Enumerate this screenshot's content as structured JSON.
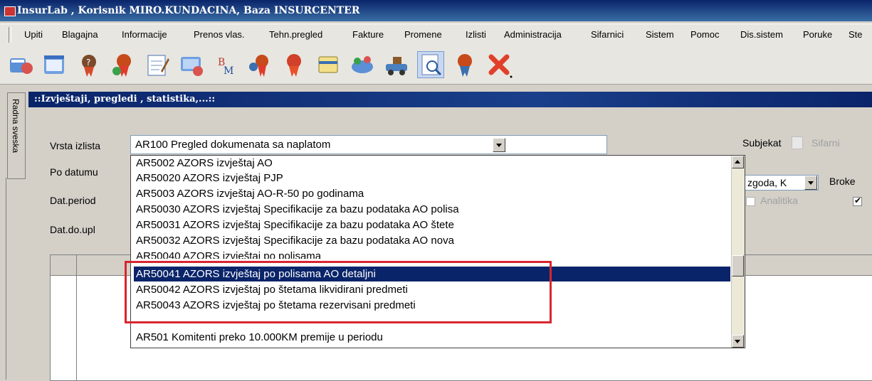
{
  "window": {
    "title": "InsurLab , Korisnik MIRO.KUNDACINA, Baza INSURCENTER"
  },
  "menu": [
    "Upiti",
    "Blagajna",
    "Informacije",
    "Prenos vlas.",
    "Tehn.pregled",
    "Fakture",
    "Promene",
    "Izlisti",
    "Administracija",
    "Sifarnici",
    "Sistem",
    "Pomoc",
    "Dis.sistem",
    "Poruke",
    "Ste"
  ],
  "toolbar_icons": [
    "users-icon",
    "window-icon",
    "ribbon-question-icon",
    "ribbon-user-icon",
    "notepad-icon",
    "computer-icon",
    "bm-icon",
    "ribbon-group-icon",
    "ribbon-red-icon",
    "card-icon",
    "network-icon",
    "car-icon",
    "search-document-icon",
    "ribbon-blue-icon",
    "exit-icon"
  ],
  "sidetab": {
    "label": "Radna sveska"
  },
  "panel": {
    "title": "::Izvještaji, pregledi , statistika,...::"
  },
  "form": {
    "vrsta_izlista_label": "Vrsta izlista",
    "po_datumu_label": "Po datumu",
    "dat_period_label": "Dat.period",
    "dat_do_upl_label": "Dat.do.upl",
    "selected_report": "AR100  Pregled dokumenata sa naplatom",
    "subjekat_label": "Subjekat",
    "sifarnik_label": "Sifarni",
    "subjekat_value": "zgoda, K",
    "broker_label": "Broke",
    "analitika_label": "Analitika"
  },
  "dropdown": {
    "items": [
      "AR5002  AZORS izvještaj AO",
      "AR50020 AZORS izvještaj PJP",
      "AR5003  AZORS izvještaj AO-R-50 po godinama",
      "AR50030  AZORS izvještaj Specifikacije za bazu podataka AO polisa",
      "AR50031  AZORS izvještaj Specifikacije za bazu podataka AO štete",
      "AR50032  AZORS izvještaj Specifikacije za bazu podataka AO nova",
      "AR50040  AZORS izvještaj po polisama",
      "AR50041  AZORS izvještaj po polisama AO detaljni",
      "AR50042  AZORS izvještaj po štetama likvidirani predmeti",
      "AR50043  AZORS izvještaj po štetama rezervisani predmeti",
      "",
      "AR501   Komitenti preko 10.000KM premije u periodu"
    ],
    "selected_index": 7
  },
  "colors": {
    "titlebar": "#0a246a",
    "selection": "#0a246a",
    "highlight_box": "#d8262f"
  }
}
